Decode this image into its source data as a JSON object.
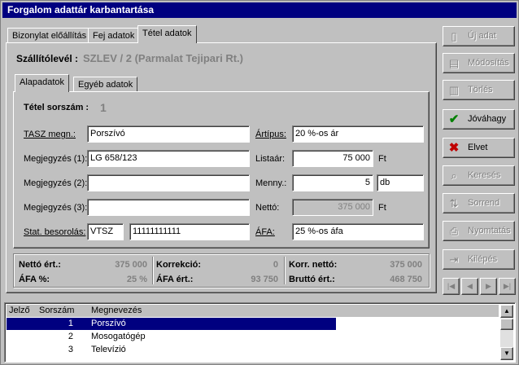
{
  "window": {
    "title": "Forgalom adattár karbantartása"
  },
  "tabs": [
    "Bizonylat előállítás",
    "Fej adatok",
    "Tétel adatok"
  ],
  "header": {
    "label": "Szállítólevél :",
    "value": "SZLEV / 2 (Parmalat Tejipari Rt.)"
  },
  "subtabs": [
    "Alapadatok",
    "Egyéb adatok"
  ],
  "form": {
    "tetel_label": "Tétel sorszám :",
    "tetel_value": "1",
    "tasz_label": "TASZ megn.:",
    "tasz_value": "Porszívó",
    "megj1_label": "Megjegyzés (1):",
    "megj1_value": "LG 658/123",
    "megj2_label": "Megjegyzés (2):",
    "megj2_value": "",
    "megj3_label": "Megjegyzés (3):",
    "megj3_value": "",
    "stat_label": "Stat. besorolás:",
    "stat_code": "VTSZ",
    "stat_value": "11111111111",
    "artipus_label": "Ártípus:",
    "artipus_value": "20 %-os ár",
    "listaar_label": "Listaár:",
    "listaar_value": "75 000",
    "listaar_unit": "Ft",
    "menny_label": "Menny.:",
    "menny_value": "5",
    "menny_unit": "db",
    "netto_label": "Nettó:",
    "netto_value": "375 000",
    "netto_unit": "Ft",
    "afa_label": "ÁFA:",
    "afa_value": "25 %-os áfa"
  },
  "summary": {
    "netto_ert_label": "Nettó ért.:",
    "netto_ert_value": "375 000",
    "afa_pct_label": "ÁFA %:",
    "afa_pct_value": "25 %",
    "korrekcio_label": "Korrekció:",
    "korrekcio_value": "0",
    "afa_ert_label": "ÁFA ért.:",
    "afa_ert_value": "93 750",
    "korr_netto_label": "Korr. nettó:",
    "korr_netto_value": "375 000",
    "brutto_label": "Bruttó ért.:",
    "brutto_value": "468 750"
  },
  "buttons": {
    "new": "Új adat",
    "modify": "Módosítás",
    "delete": "Törlés",
    "approve": "Jóváhagy",
    "discard": "Elvet",
    "search": "Keresés",
    "order": "Sorrend",
    "print": "Nyomtatás",
    "exit": "Kilépés"
  },
  "colors": {
    "approve_icon": "#008000",
    "discard_icon": "#c00000",
    "selection": "#000080"
  },
  "grid": {
    "columns": [
      "Jelző",
      "Sorszám",
      "Megnevezés"
    ],
    "rows": [
      {
        "jelzo": "",
        "sorszam": "1",
        "megnevezes": "Porszívó",
        "selected": true
      },
      {
        "jelzo": "",
        "sorszam": "2",
        "megnevezes": "Mosogatógép",
        "selected": false
      },
      {
        "jelzo": "",
        "sorszam": "3",
        "megnevezes": "Televízió",
        "selected": false
      }
    ]
  }
}
